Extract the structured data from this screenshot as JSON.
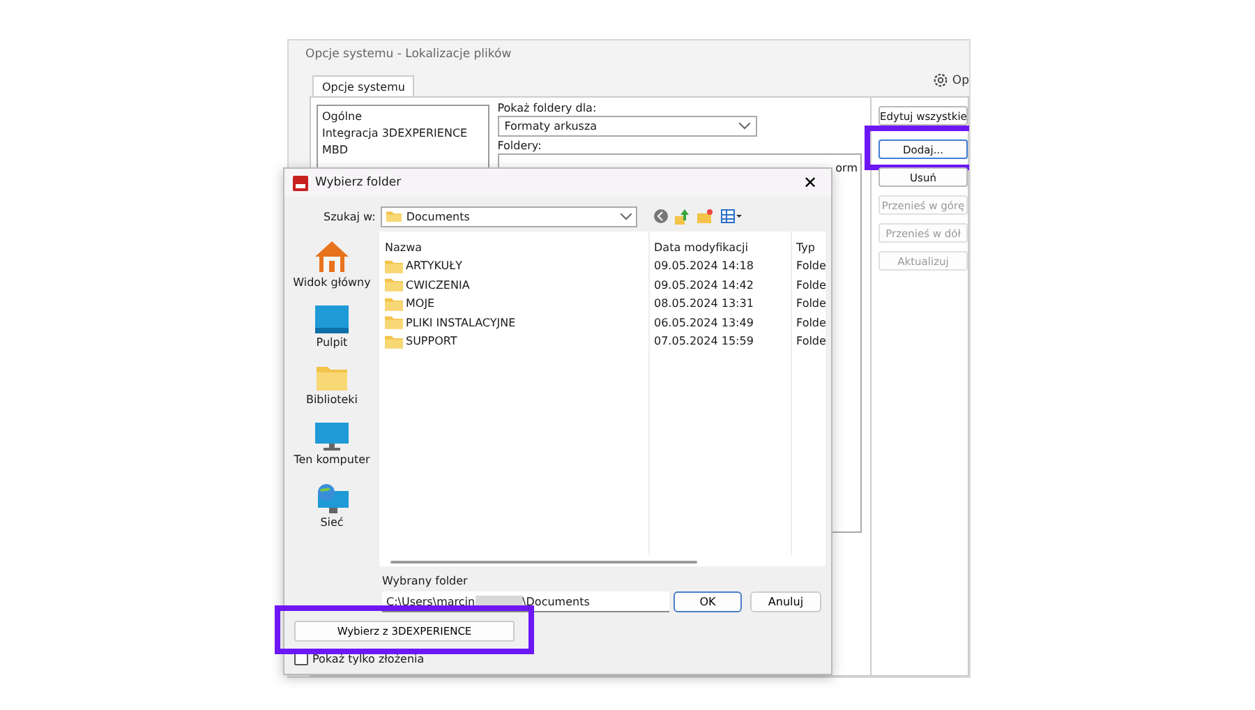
{
  "background_window": {
    "title": "Opcje systemu - Lokalizacje plików",
    "tabs": [
      {
        "label": "Opcje systemu",
        "selected": true
      }
    ],
    "options_button": "Op",
    "categories": [
      "Ogólne",
      "Integracja 3DEXPERIENCE",
      "MBD"
    ],
    "show_folders_label": "Pokaż foldery dla:",
    "show_folders_value": "Formaty arkusza",
    "folders_label": "Foldery:",
    "folders_list": [
      "orm"
    ],
    "edit_all_button": "Edytuj wszystkie",
    "buttons": [
      {
        "label": "Dodaj...",
        "disabled": false,
        "highlighted": true
      },
      {
        "label": "Usuń",
        "disabled": false,
        "highlighted": false
      },
      {
        "label": "Przenieś w górę",
        "disabled": true,
        "highlighted": false
      },
      {
        "label": "Przenieś w dół",
        "disabled": true,
        "highlighted": false
      },
      {
        "label": "Aktualizuj",
        "disabled": true,
        "highlighted": false
      }
    ]
  },
  "dialog": {
    "title": "Wybierz folder",
    "close_button": "✕",
    "look_in_label": "Szukaj w:",
    "look_in_value": "Documents",
    "places": [
      {
        "label": "Widok główny",
        "kind": "home"
      },
      {
        "label": "Pulpit",
        "kind": "desktop"
      },
      {
        "label": "Biblioteki",
        "kind": "libraries"
      },
      {
        "label": "Ten komputer",
        "kind": "computer"
      },
      {
        "label": "Sieć",
        "kind": "network"
      }
    ],
    "columns": [
      "Nazwa",
      "Data modyfikacji",
      "Typ"
    ],
    "rows": [
      [
        "ARTYKUŁY",
        "09.05.2024 14:18",
        "Folde"
      ],
      [
        "CWICZENIA",
        "09.05.2024 14:42",
        "Folde"
      ],
      [
        "MOJE",
        "08.05.2024 13:31",
        "Folde"
      ],
      [
        "PLIKI INSTALACYJNE",
        "06.05.2024 13:49",
        "Folde"
      ],
      [
        "SUPPORT",
        "07.05.2024 15:59",
        "Folde"
      ]
    ],
    "selected_folder_label": "Wybrany folder",
    "path_start": "C:\\Users\\marcin",
    "path_end": "\\Documents",
    "ok_button": "OK",
    "cancel_button": "Anuluj",
    "pick_3dx_button": {
      "label": "Wybierz z 3DEXPERIENCE",
      "highlighted": true
    },
    "assemblies_only": {
      "label": "Pokaż tylko złożenia",
      "checked": false
    }
  }
}
